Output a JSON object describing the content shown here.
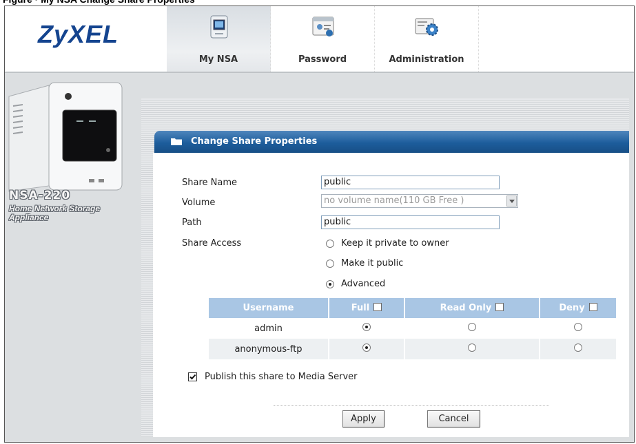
{
  "brand": {
    "logo": "ZyXEL"
  },
  "tabs": [
    {
      "label": "My NSA",
      "icon": "nas-device-icon",
      "active": true
    },
    {
      "label": "Password",
      "icon": "password-id-card-icon",
      "active": false
    },
    {
      "label": "Administration",
      "icon": "administration-gear-icon",
      "active": false
    }
  ],
  "sidebar": {
    "model_name": "NSA-220",
    "model_description": "Home Network Storage Appliance",
    "device_image": "nas-device-image"
  },
  "panel": {
    "title": "Change Share Properties",
    "icon": "folder-icon",
    "accent_color": "#1d5d9c"
  },
  "form": {
    "share_name_label": "Share Name",
    "share_name_value": "public",
    "volume_label": "Volume",
    "volume_value": "no volume name(110 GB Free )",
    "path_label": "Path",
    "path_value": "public",
    "share_access_label": "Share Access",
    "access_options": [
      {
        "label": "Keep it private to owner",
        "selected": false
      },
      {
        "label": "Make it public",
        "selected": false
      },
      {
        "label": "Advanced",
        "selected": true
      }
    ]
  },
  "permissions": {
    "headers": [
      "Username",
      "Full",
      "Read Only",
      "Deny"
    ],
    "rows": [
      {
        "username": "admin",
        "selected": "Full"
      },
      {
        "username": "anonymous-ftp",
        "selected": "Full"
      }
    ],
    "header_color": "#a9c6e4"
  },
  "publish": {
    "label": "Publish this share to Media Server",
    "checked": true
  },
  "buttons": {
    "apply": "Apply",
    "cancel": "Cancel"
  }
}
